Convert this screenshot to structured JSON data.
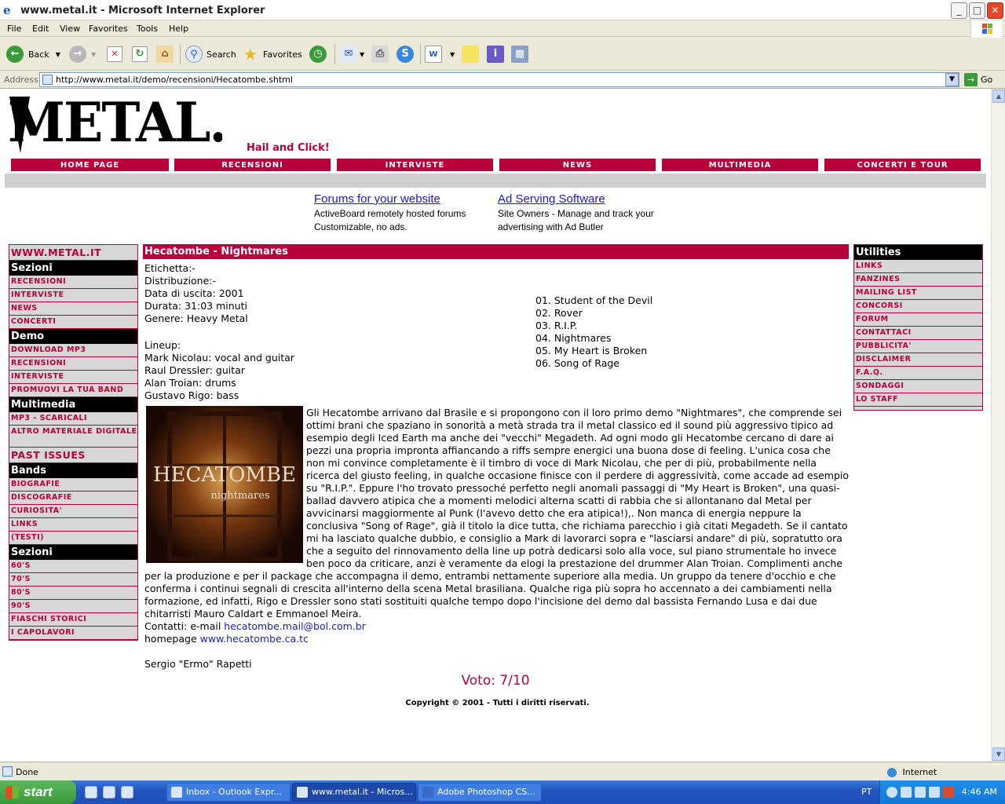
{
  "window": {
    "title": "www.metal.it - Microsoft Internet Explorer",
    "minimize": "_",
    "maximize": "□",
    "close": "✕"
  },
  "menu": [
    "File",
    "Edit",
    "View",
    "Favorites",
    "Tools",
    "Help"
  ],
  "toolbar": {
    "back": "Back",
    "search": "Search",
    "favorites": "Favorites"
  },
  "address": {
    "label": "Address",
    "url": "http://www.metal.it/demo/recensioni/Hecatombe.shtml",
    "go": "Go"
  },
  "site": {
    "logo_text": "METAL.IT",
    "tagline": "Hail and Click!",
    "nav": [
      "HOME PAGE",
      "RECENSIONI",
      "INTERVISTE",
      "NEWS",
      "MULTIMEDIA",
      "CONCERTI E TOUR"
    ],
    "ads": [
      {
        "title": "Forums for your website",
        "line1": "ActiveBoard remotely hosted forums",
        "line2": "Customizable, no ads."
      },
      {
        "title": "Ad Serving Software",
        "line1": "Site Owners - Manage and track your",
        "line2": "advertising with Ad Butler"
      }
    ]
  },
  "sidebar": {
    "brand": "WWW.METAL.IT",
    "sezioni": {
      "heading": "Sezioni",
      "items": [
        "RECENSIONI",
        "INTERVISTE",
        "NEWS",
        "CONCERTI"
      ]
    },
    "demo": {
      "heading": "Demo",
      "items": [
        "DOWNLOAD MP3",
        "RECENSIONI",
        "INTERVISTE",
        "PROMUOVI LA TUA BAND"
      ]
    },
    "multimedia": {
      "heading": "Multimedia",
      "items": [
        "MP3 - SCARICALI",
        "ALTRO MATERIALE DIGITALE"
      ]
    },
    "past_issues": "PAST ISSUES",
    "bands": {
      "heading": "Bands",
      "items": [
        "BIOGRAFIE",
        "DISCOGRAFIE",
        "CURIOSITA'",
        "LINKS",
        "(TESTI)"
      ]
    },
    "sezioni2": {
      "heading": "Sezioni",
      "items": [
        "60'S",
        "70'S",
        "80'S",
        "90'S",
        "FIASCHI STORICI",
        "I CAPOLAVORI"
      ]
    }
  },
  "utilities": {
    "heading": "Utilities",
    "items": [
      "LINKS",
      "FANZINES",
      "MAILING LIST",
      "CONCORSI",
      "FORUM",
      "CONTATTACI",
      "PUBBLICITA'",
      "DISCLAIMER",
      "F.A.Q.",
      "SONDAGGI",
      "LO STAFF"
    ]
  },
  "review": {
    "title": "Hecatombe - Nightmares",
    "info": [
      "Etichetta:-",
      "Distribuzione:-",
      "Data di uscita: 2001",
      "Durata: 31:03 minuti",
      "Genere: Heavy Metal"
    ],
    "lineup_label": "Lineup:",
    "lineup": [
      "Mark Nicolau: vocal and guitar",
      "Raul Dressler: guitar",
      "Alan Troian: drums",
      "Gustavo Rigo: bass"
    ],
    "tracks": [
      "01. Student of the Devil",
      "02. Rover",
      "03. R.I.P.",
      "04. Nightmares",
      "05. My Heart is Broken",
      "06. Song of Rage"
    ],
    "cover_band": "HECATOMBE",
    "cover_album": "nightmares",
    "text": "Gli Hecatombe arrivano dal Brasile e si propongono con il loro primo demo \"Nightmares\", che comprende sei ottimi brani che spaziano in sonorità a metà strada tra il metal classico ed il sound più aggressivo tipico ad esempio degli Iced Earth ma anche dei \"vecchi\" Megadeth. Ad ogni modo gli Hecatombe cercano di dare ai pezzi una propria impronta affiancando a riffs sempre energici una buona dose di feeling. L'unica cosa che non mi convince completamente è il timbro di voce di Mark Nicolau, che per di più, probabilmente nella ricerca del giusto feeling, in qualche occasione finisce con il perdere di aggressività, come accade ad esempio su \"R.I.P.\". Eppure l'ho trovato pressoché perfetto negli anomali passaggi di \"My Heart is Broken\", una quasi-ballad davvero atipica che a momenti melodici alterna scatti di rabbia che si allontanano dal Metal per avvicinarsi maggiormente al Punk (l'avevo detto che era atipica!),. Non manca di energia neppure la conclusiva \"Song of Rage\", già il titolo la dice tutta, che richiama parecchio i già citati Megadeth. Se il cantato mi ha lasciato qualche dubbio, e consiglio a Mark di lavorarci sopra e \"lasciarsi andare\" di più, sopratutto ora che a seguito del rinnovamento della line up potrà dedicarsi solo alla voce, sul piano strumentale ho invece ben poco da criticare, anzi è veramente da elogi la prestazione del drummer Alan Troian. Complimenti anche per la produzione e per il package che accompagna il demo, entrambi nettamente superiore alla media. Un gruppo da tenere d'occhio e che conferma i continui segnali di crescita all'interno della scena Metal brasiliana. Qualche riga più sopra ho accennato a dei cambiamenti nella formazione, ed infatti, Rigo e Dressler sono stati sostituiti qualche tempo dopo l'incisione del demo dal bassista Fernando Lusa e dai due chitarristi Mauro Caldart e Emmanoel Meira.",
    "contact_label": "Contatti: e-mail",
    "email": "hecatombe.mail@bol.com.br",
    "homepage_label": "homepage",
    "homepage": "www.hecatombe.ca.tc",
    "author": "Sergio \"Ermo\" Rapetti",
    "voto": "Voto: 7/10",
    "copyright": "Copyright © 2001 - Tutti i diritti riservati."
  },
  "status": {
    "text": "Done",
    "zone": "Internet"
  },
  "taskbar": {
    "start": "start",
    "tasks": [
      "Inbox - Outlook Expr...",
      "www.metal.it - Micros...",
      "Adobe Photoshop CS..."
    ],
    "lang": "PT",
    "clock": "4:46 AM"
  },
  "colors": {
    "brand": "#b8003a",
    "link": "#1a1acc"
  }
}
